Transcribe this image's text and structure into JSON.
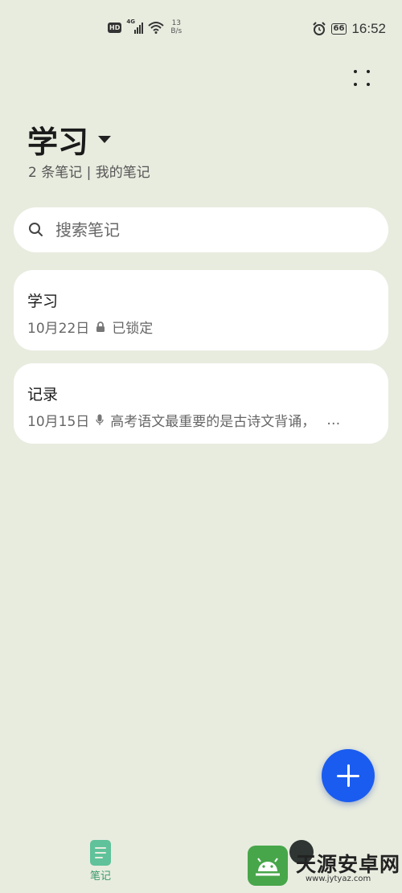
{
  "status_bar": {
    "hd_label": "HD",
    "network_type": "4G",
    "net_speed_value": "13",
    "net_speed_unit": "B/s",
    "battery": "66",
    "time": "16:52"
  },
  "header": {
    "title": "学习",
    "subtitle": "2 条笔记 | 我的笔记"
  },
  "search": {
    "placeholder": "搜索笔记"
  },
  "notes": [
    {
      "title": "学习",
      "date": "10月22日",
      "icon": "lock-icon",
      "preview": "已锁定"
    },
    {
      "title": "记录",
      "date": "10月15日",
      "icon": "mic-icon",
      "preview": "高考语文最重要的是古诗文背诵，",
      "ellipsis": "…"
    }
  ],
  "bottom_nav": {
    "notes_label": "笔记"
  },
  "watermark": {
    "name": "天源安卓网",
    "url": "www.jytyaz.com"
  },
  "colors": {
    "background": "#e8ecdf",
    "fab": "#1a5cf0",
    "nav_active": "#3b9a6d"
  }
}
